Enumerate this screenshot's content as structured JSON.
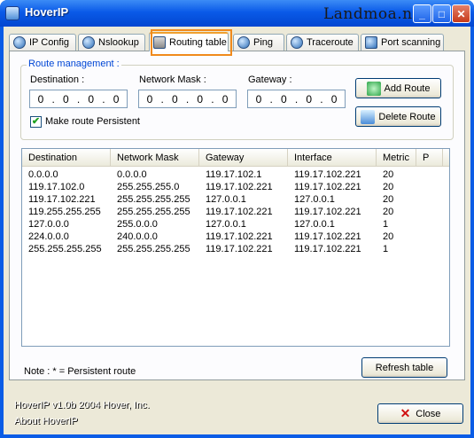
{
  "window": {
    "title": "HoverIP",
    "watermark": "Landmoa.net",
    "controls": {
      "minimize": "_",
      "maximize": "□",
      "close": "✕"
    }
  },
  "tabs": [
    {
      "label": "IP Config",
      "icon": "ip-config-icon"
    },
    {
      "label": "Nslookup",
      "icon": "globe-icon"
    },
    {
      "label": "Routing table",
      "icon": "network-icon",
      "active": true
    },
    {
      "label": "Ping",
      "icon": "ping-icon"
    },
    {
      "label": "Traceroute",
      "icon": "traceroute-icon"
    },
    {
      "label": "Port scanning",
      "icon": "port-scan-icon"
    }
  ],
  "route_management": {
    "title": "Route management :",
    "destination": {
      "label": "Destination :",
      "octets": [
        "0",
        "0",
        "0",
        "0"
      ]
    },
    "netmask": {
      "label": "Network Mask :",
      "octets": [
        "0",
        "0",
        "0",
        "0"
      ]
    },
    "gateway": {
      "label": "Gateway :",
      "octets": [
        "0",
        "0",
        "0",
        "0"
      ]
    },
    "persistent": {
      "label": "Make route Persistent",
      "checked": true
    },
    "add_button": "Add Route",
    "delete_button": "Delete Route"
  },
  "route_table": {
    "columns": [
      "Destination",
      "Network Mask",
      "Gateway",
      "Interface",
      "Metric",
      "P"
    ],
    "rows": [
      [
        "0.0.0.0",
        "0.0.0.0",
        "119.17.102.1",
        "119.17.102.221",
        "20",
        ""
      ],
      [
        "119.17.102.0",
        "255.255.255.0",
        "119.17.102.221",
        "119.17.102.221",
        "20",
        ""
      ],
      [
        "119.17.102.221",
        "255.255.255.255",
        "127.0.0.1",
        "127.0.0.1",
        "20",
        ""
      ],
      [
        "119.255.255.255",
        "255.255.255.255",
        "119.17.102.221",
        "119.17.102.221",
        "20",
        ""
      ],
      [
        "127.0.0.0",
        "255.0.0.0",
        "127.0.0.1",
        "127.0.0.1",
        "1",
        ""
      ],
      [
        "224.0.0.0",
        "240.0.0.0",
        "119.17.102.221",
        "119.17.102.221",
        "20",
        ""
      ],
      [
        "255.255.255.255",
        "255.255.255.255",
        "119.17.102.221",
        "119.17.102.221",
        "1",
        ""
      ]
    ]
  },
  "note": "Note : * = Persistent route",
  "refresh_button": "Refresh table",
  "footer": {
    "version": "HoverIP v1.0b 2004 Hover, Inc.",
    "about": "About HoverIP",
    "close_button": "Close"
  },
  "colors": {
    "accent": "#0046d5",
    "highlight": "#f08a1c",
    "titlebar": "#0a5ce6"
  }
}
